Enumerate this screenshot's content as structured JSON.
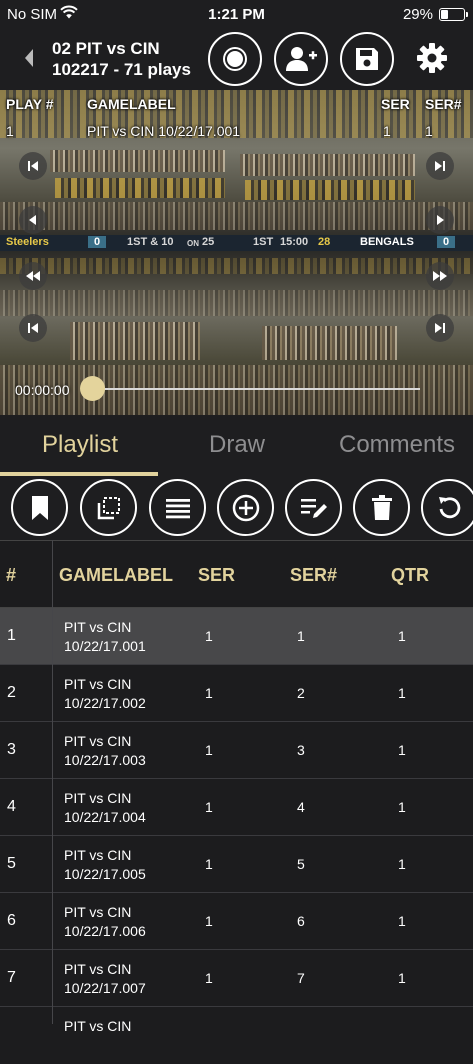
{
  "status_bar": {
    "carrier": "No SIM",
    "time": "1:21 PM",
    "battery": "29%"
  },
  "nav": {
    "title_line1": "02 PIT vs CIN",
    "title_line2": "102217 - 71 plays"
  },
  "video": {
    "header": {
      "play": "PLAY #",
      "gamelabel": "GAMELABEL",
      "ser": "SER",
      "ser_num": "SER#"
    },
    "current": {
      "play": "1",
      "gamelabel": "PIT vs CIN 10/22/17.001",
      "ser": "1",
      "ser_num": "1"
    },
    "scoreboard": {
      "team_home": "Steelers",
      "home_score": "0",
      "down": "1ST & 10",
      "on": "ON",
      "yard": "25",
      "quarter": "1ST",
      "clock": "15:00",
      "timeout": "28",
      "team_away": "BENGALS",
      "away_score": "0"
    },
    "timecode": "00:00:00",
    "progress": 0
  },
  "tabs": [
    "Playlist",
    "Draw",
    "Comments"
  ],
  "active_tab": "Playlist",
  "toolbar_icons": [
    "bookmark-icon",
    "crop-icon",
    "list-icon",
    "add-circle-icon",
    "edit-list-icon",
    "trash-icon",
    "undo-icon"
  ],
  "table": {
    "headers": [
      "#",
      "GAMELABEL",
      "SER",
      "SER#",
      "QTR"
    ],
    "rows": [
      {
        "num": "1",
        "label_line1": "PIT vs CIN",
        "label_line2": "10/22/17.001",
        "ser": "1",
        "ser_num": "1",
        "qtr": "1",
        "selected": true
      },
      {
        "num": "2",
        "label_line1": "PIT vs CIN",
        "label_line2": "10/22/17.002",
        "ser": "1",
        "ser_num": "2",
        "qtr": "1"
      },
      {
        "num": "3",
        "label_line1": "PIT vs CIN",
        "label_line2": "10/22/17.003",
        "ser": "1",
        "ser_num": "3",
        "qtr": "1"
      },
      {
        "num": "4",
        "label_line1": "PIT vs CIN",
        "label_line2": "10/22/17.004",
        "ser": "1",
        "ser_num": "4",
        "qtr": "1"
      },
      {
        "num": "5",
        "label_line1": "PIT vs CIN",
        "label_line2": "10/22/17.005",
        "ser": "1",
        "ser_num": "5",
        "qtr": "1"
      },
      {
        "num": "6",
        "label_line1": "PIT vs CIN",
        "label_line2": "10/22/17.006",
        "ser": "1",
        "ser_num": "6",
        "qtr": "1"
      },
      {
        "num": "7",
        "label_line1": "PIT vs CIN",
        "label_line2": "10/22/17.007",
        "ser": "1",
        "ser_num": "7",
        "qtr": "1"
      },
      {
        "num": "",
        "label_line1": "PIT vs CIN",
        "label_line2": "",
        "ser": "",
        "ser_num": "",
        "qtr": ""
      }
    ]
  },
  "colors": {
    "accent": "#e2d39d",
    "background": "#1c1c1e",
    "selected_row": "#48484a"
  }
}
